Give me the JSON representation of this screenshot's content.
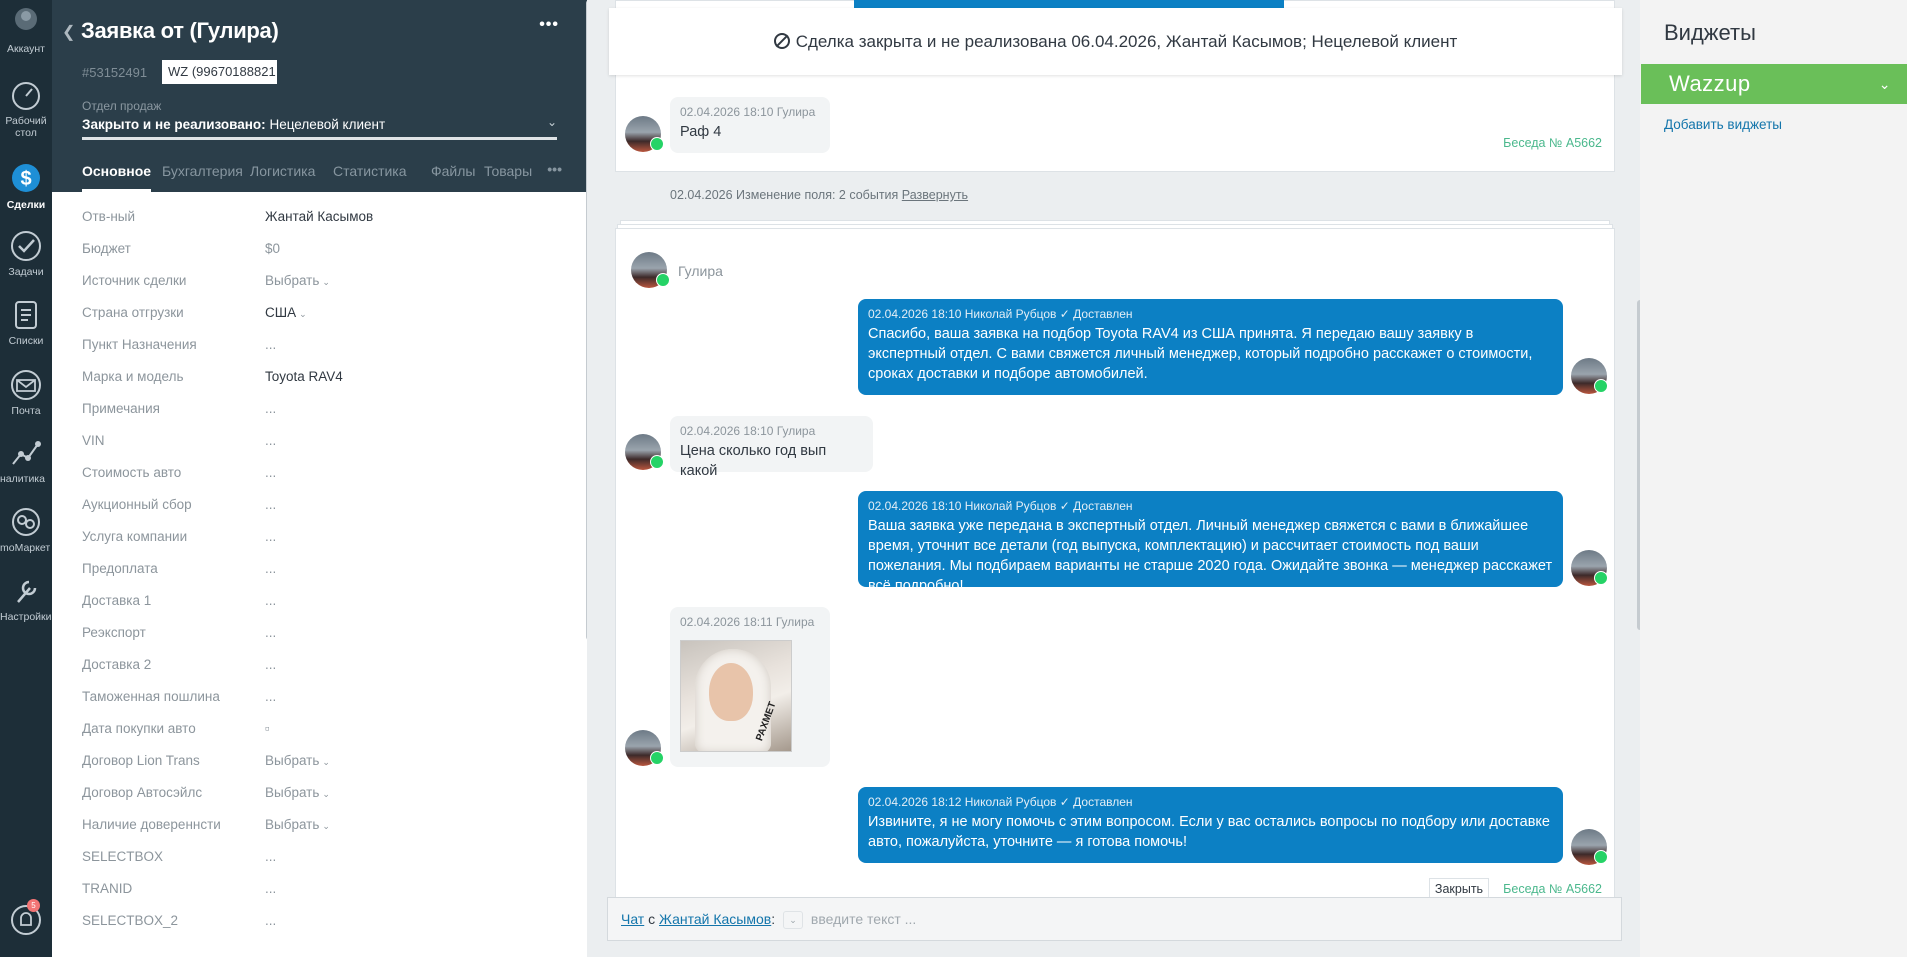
{
  "nav": {
    "items": [
      {
        "label": "Аккаунт",
        "icon": "account-icon"
      },
      {
        "label": "Рабочий стол",
        "icon": "dashboard-icon"
      },
      {
        "label": "Сделки",
        "icon": "deals-icon"
      },
      {
        "label": "Задачи",
        "icon": "tasks-icon"
      },
      {
        "label": "Списки",
        "icon": "lists-icon"
      },
      {
        "label": "Почта",
        "icon": "mail-icon"
      },
      {
        "label": "налитика",
        "icon": "analytics-icon"
      },
      {
        "label": "moМаркет",
        "icon": "market-icon"
      },
      {
        "label": "Настройки",
        "icon": "settings-icon"
      }
    ],
    "notifications_badge": "5"
  },
  "card": {
    "title": "Заявка от (Гулира)",
    "more": "•••",
    "deal_id": "#53152491",
    "tag": "WZ (99670188821",
    "pipeline_label": "Отдел продаж",
    "status_bold": "Закрыто и не реализовано:",
    "status_reason": "Нецелевой клиент",
    "tabs": [
      "Основное",
      "Бухгалтерия",
      "Логистика",
      "Статистика",
      "Файлы",
      "Товары"
    ],
    "tabs_more": "•••",
    "fields": [
      {
        "label": "Отв-ный",
        "value": "Жантай Касымов"
      },
      {
        "label": "Бюджет",
        "value": "$0"
      },
      {
        "label": "Источник сделки",
        "value": "Выбрать"
      },
      {
        "label": "Страна отгрузки",
        "value": "США"
      },
      {
        "label": "Пункт Назначения",
        "value": "..."
      },
      {
        "label": "Марка и модель",
        "value": "Toyota RAV4"
      },
      {
        "label": "Примечания",
        "value": "..."
      },
      {
        "label": "VIN",
        "value": "..."
      },
      {
        "label": "Стоимость авто",
        "value": "..."
      },
      {
        "label": "Аукционный сбор",
        "value": "..."
      },
      {
        "label": "Услуга компании",
        "value": "..."
      },
      {
        "label": "Предоплата",
        "value": "..."
      },
      {
        "label": "Доставка 1",
        "value": "..."
      },
      {
        "label": "Реэкспорт",
        "value": "..."
      },
      {
        "label": "Доставка 2",
        "value": "..."
      },
      {
        "label": "Таможенная пошлина",
        "value": "..."
      },
      {
        "label": "Дата покупки авто",
        "value": "▫"
      },
      {
        "label": "Договор Lion Trans",
        "value": "Выбрать"
      },
      {
        "label": "Договор Автосэйлс",
        "value": "Выбрать"
      },
      {
        "label": "Наличие довереннсти",
        "value": "Выбрать"
      },
      {
        "label": "SELECTBOX",
        "value": "..."
      },
      {
        "label": "TRANID",
        "value": "..."
      },
      {
        "label": "SELECTBOX_2",
        "value": "..."
      }
    ]
  },
  "feed": {
    "closed_banner": "Сделка закрыта и не реализована 06.04.2026, Жантай Касымов; Нецелевой клиент",
    "block1": {
      "meta": "02.04.2026 18:10 Гулира",
      "text": "Раф 4",
      "talk": "Беседа № А5662"
    },
    "field_change": "02.04.2026 Изменение поля: 2 события",
    "field_change_link": "Развернуть",
    "chat_name": "Гулира",
    "messages": [
      {
        "dir": "out",
        "meta": "02.04.2026 18:10 Николай Рубцов",
        "status": "✓ Доставлен",
        "text": "Спасибо, ваша заявка на подбор Toyota RAV4 из США принята. Я передаю вашу заявку в экспертный отдел. С вами свяжется личный менеджер, который подробно расскажет о стоимости, сроках доставки и подборе автомобилей."
      },
      {
        "dir": "in",
        "meta": "02.04.2026 18:10 Гулира",
        "text": "Цена сколько год вып какой"
      },
      {
        "dir": "out",
        "meta": "02.04.2026 18:10 Николай Рубцов",
        "status": "✓ Доставлен",
        "text": "Ваша заявка уже передана в экспертный отдел. Личный менеджер свяжется с вами в ближайшее время, уточнит все детали (год выпуска, комплектацию) и рассчитает стоимость под ваши пожелания. Мы подбираем варианты не старше 2020 года. Ожидайте звонка — менеджер расскажет всё подробно!"
      },
      {
        "dir": "in",
        "meta": "02.04.2026 18:11 Гулира",
        "text": "",
        "photo_caption": "РАХМЕТ"
      },
      {
        "dir": "out",
        "meta": "02.04.2026 18:12 Николай Рубцов",
        "status": "✓ Доставлен",
        "text": "Извините, я не могу помочь с этим вопросом. Если у вас остались вопросы по подбору или доставке авто, пожалуйста, уточните — я готова помочь!"
      }
    ],
    "close_label": "Закрыть",
    "talk2": "Беседа № А5662",
    "composer": {
      "chat": "Чат",
      "with": "с",
      "contact": "Жантай Касымов",
      "placeholder": "введите текст ..."
    }
  },
  "widgets": {
    "title": "Виджеты",
    "wazzup": "Wazzup",
    "add": "Добавить виджеты"
  }
}
